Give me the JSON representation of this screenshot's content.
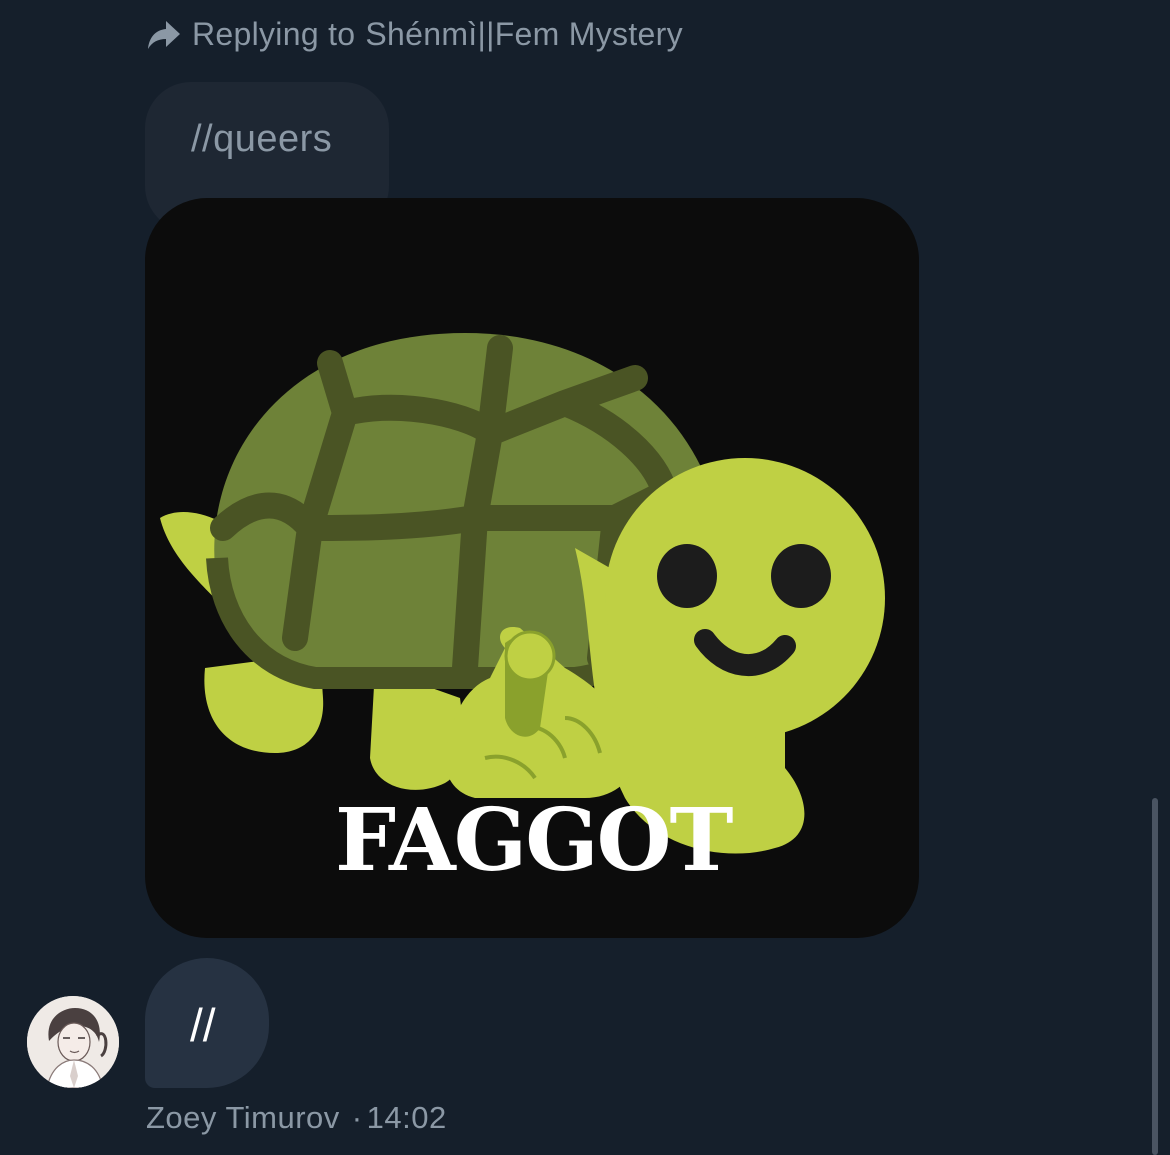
{
  "reply": {
    "prefix": "Replying to",
    "name": "Shénmì||Fem Mystery",
    "icon": "reply-arrow-icon"
  },
  "quoted_message": {
    "text": "//queers"
  },
  "image_message": {
    "caption_text": "FAGGOT",
    "depicts": "turtle-pointing-sticker"
  },
  "message": {
    "text": "//",
    "author": "Zoey Timurov",
    "separator": "·",
    "time": "14:02",
    "avatar": "user-avatar"
  },
  "colors": {
    "background": "#151f2b",
    "bubble": "#263242",
    "muted_text": "#8b98a5",
    "shell": "#6e8238",
    "shell_lines": "#4a5424",
    "turtle_body": "#bfd044",
    "sticker_bg": "#0c0c0c"
  }
}
